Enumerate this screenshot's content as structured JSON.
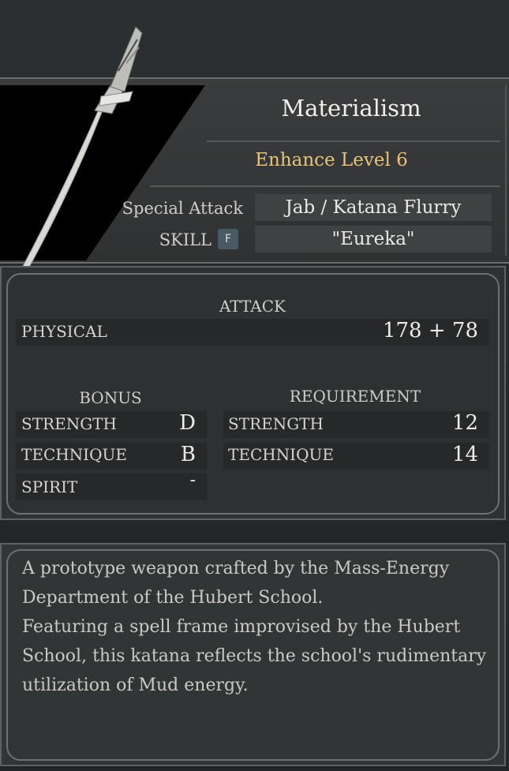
{
  "weapon": {
    "name": "Materialism",
    "enhance": "Enhance Level 6",
    "special_attack_label": "Special Attack",
    "special_attack_value": "Jab / Katana Flurry",
    "skill_label": "SKILL",
    "skill_key": "F",
    "skill_value": "\"Eureka\""
  },
  "attack": {
    "heading": "ATTACK",
    "physical_label": "PHYSICAL",
    "physical_value": "178 + 78"
  },
  "bonus": {
    "heading": "BONUS",
    "rows": [
      {
        "label": "STRENGTH",
        "value": "D"
      },
      {
        "label": "TECHNIQUE",
        "value": "B"
      },
      {
        "label": "SPIRIT",
        "value": "-"
      }
    ]
  },
  "requirement": {
    "heading": "REQUIREMENT",
    "rows": [
      {
        "label": "STRENGTH",
        "value": "12"
      },
      {
        "label": "TECHNIQUE",
        "value": "14"
      }
    ]
  },
  "description": {
    "lines": [
      "A prototype weapon crafted by the Mass-Energy Department of the Hubert School.",
      "Featuring a spell frame improvised by the Hubert School, this katana reflects the school's rudimentary utilization of Mud energy."
    ]
  },
  "colors": {
    "enhance_gold": "#e8c37a",
    "panel_dark": "#2e3132",
    "frame_gray": "#6e7071"
  }
}
